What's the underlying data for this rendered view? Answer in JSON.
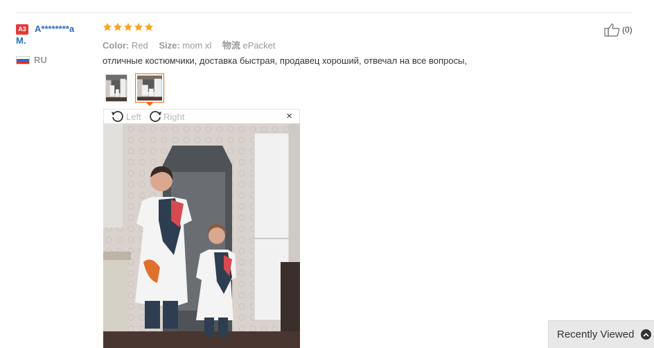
{
  "review": {
    "user": {
      "level_badge": "A3",
      "name_line1": "A********a",
      "name_line2": "M.",
      "country": "RU"
    },
    "rating_stars": 5,
    "meta": {
      "color_label": "Color:",
      "color_value": "Red",
      "size_label": "Size:",
      "size_value": "mom xl",
      "logistics_label": "物流",
      "logistics_value": "ePacket"
    },
    "text": "отличные костюмчики, доставка быстрая, продавец хороший, отвечал на все вопросы,",
    "helpful_count": "(0)",
    "viewer": {
      "rotate_left_label": "Left",
      "rotate_right_label": "Right",
      "close_label": "×"
    }
  },
  "recently_viewed": {
    "label": "Recently Viewed"
  },
  "colors": {
    "star": "#f5a623",
    "username": "#2a6ebb",
    "badge": "#e4393c",
    "selected_thumb_border": "#ff6600"
  },
  "icons": [
    "star-icon",
    "thumbs-up-icon",
    "rotate-left-icon",
    "rotate-right-icon",
    "close-icon",
    "chevron-up-icon",
    "russia-flag-icon"
  ]
}
